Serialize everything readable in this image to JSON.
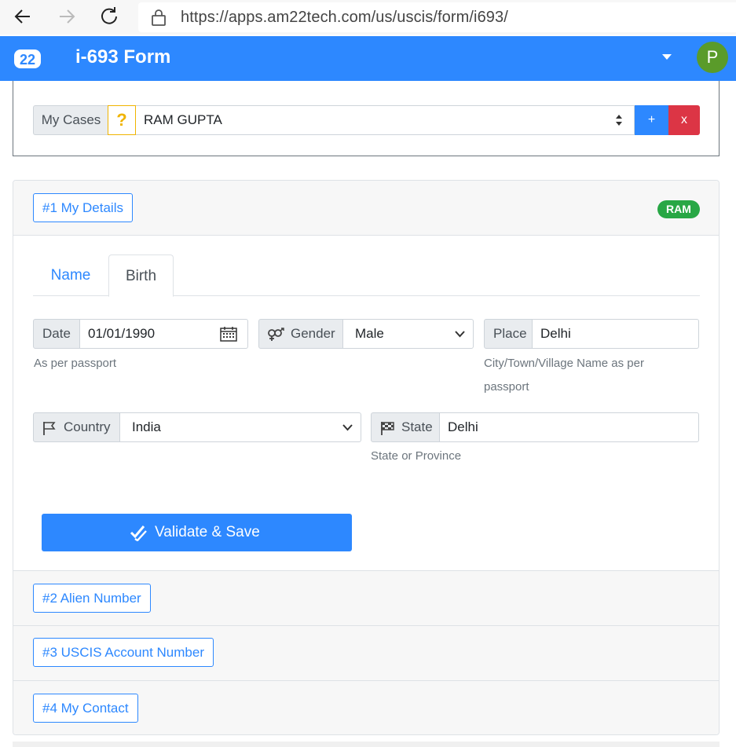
{
  "browser": {
    "url": "https://apps.am22tech.com/us/uscis/form/i693/",
    "icons": [
      "back-arrow-icon",
      "forward-arrow-icon",
      "reload-icon",
      "lock-icon"
    ]
  },
  "header": {
    "logo_text": "22",
    "title": "i-693 Form",
    "avatar_letter": "P",
    "accent": "#2d88ff"
  },
  "cases": {
    "label": "My Cases",
    "help": "?",
    "selected": "RAM GUPTA",
    "add_label": "+",
    "delete_label": "x"
  },
  "sections": [
    {
      "label": "#1 My Details",
      "badge": "RAM"
    },
    {
      "label": "#2 Alien Number"
    },
    {
      "label": "#3 USCIS Account Number"
    },
    {
      "label": "#4 My Contact"
    }
  ],
  "tabs": [
    {
      "label": "Name",
      "active": false
    },
    {
      "label": "Birth",
      "active": true
    }
  ],
  "birth": {
    "date_label": "Date",
    "date_value": "01/01/1990",
    "date_help": "As per passport",
    "gender_label": "Gender",
    "gender_value": "Male",
    "place_label": "Place",
    "place_value": "Delhi",
    "place_help": "City/Town/Village Name as per passport",
    "country_label": "Country",
    "country_value": "India",
    "state_label": "State",
    "state_value": "Delhi",
    "state_help": "State or Province"
  },
  "actions": {
    "save_label": "Validate & Save"
  },
  "colors": {
    "primary": "#2d88ff",
    "danger": "#dc3545",
    "success": "#28a745",
    "warning": "#f0b400",
    "avatar": "#5a9b2a"
  }
}
